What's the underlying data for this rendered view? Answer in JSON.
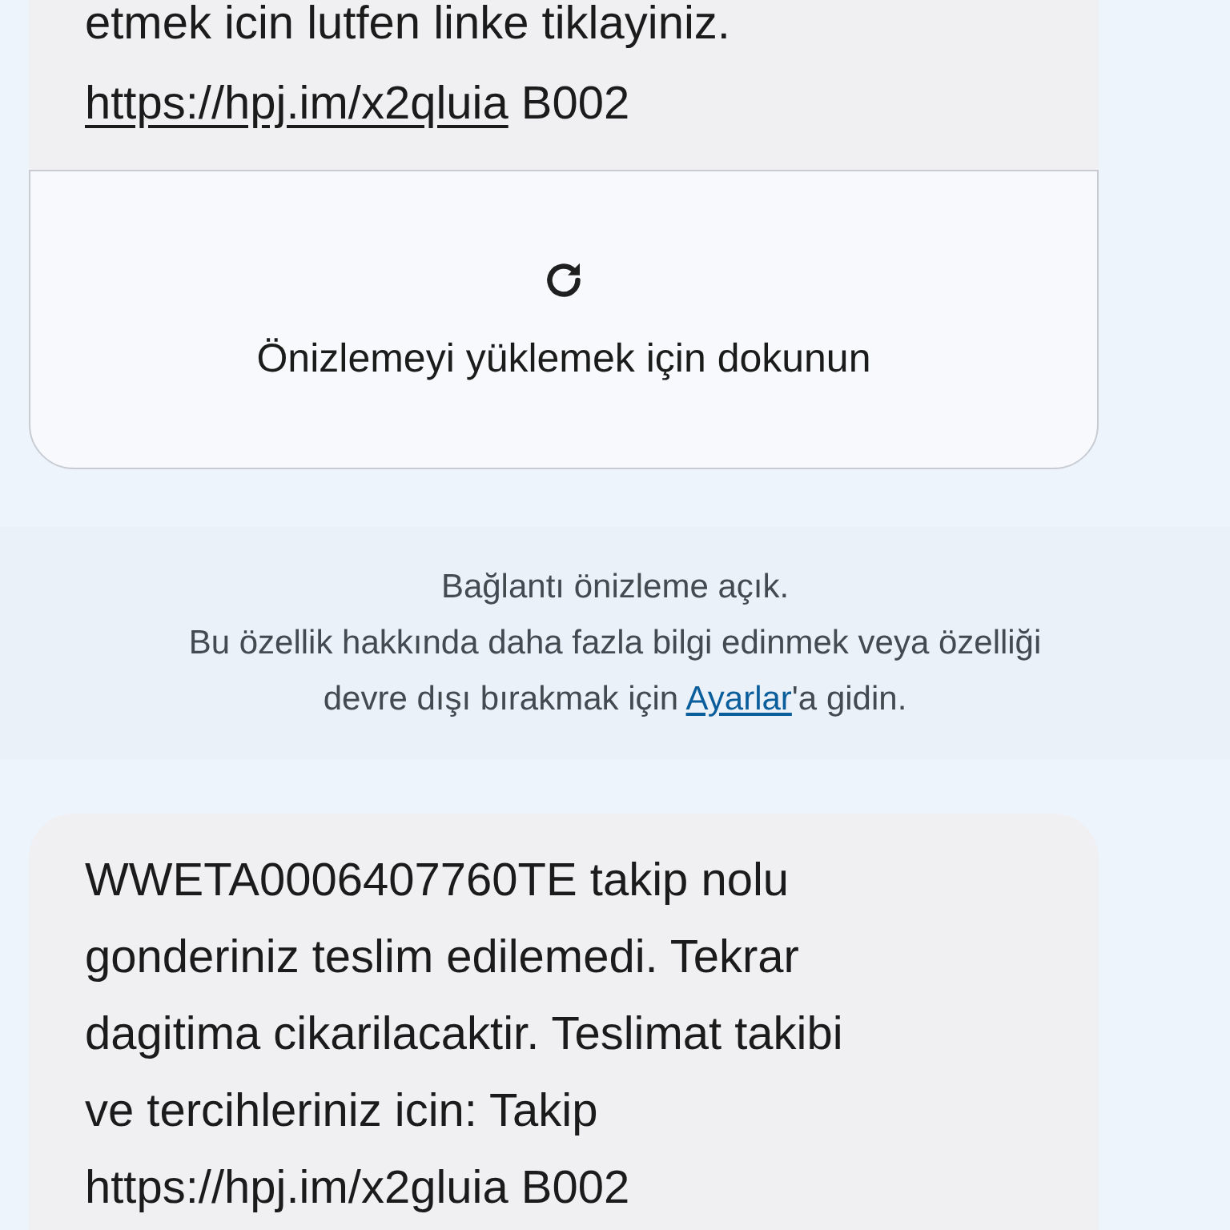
{
  "messages": [
    {
      "kind": "link_preview",
      "text_before": "etmek icin lutfen linke tiklayiniz.\n",
      "link": "https://hpj.im/x2qluia",
      "text_after": " B002",
      "preview": {
        "label": "Önizlemeyi yüklemek için dokunun"
      }
    },
    {
      "kind": "plain",
      "text": "WWETA0006407760TE takip nolu\ngonderiniz teslim edilemedi. Tekrar\ndagitima cikarilacaktir. Teslimat takibi\nve tercihleriniz icin: Takip\nhttps://hpj.im/x2gluia B002"
    }
  ],
  "notice": {
    "title": "Bağlantı önizleme açık.",
    "text_before": "Bu özellik hakkında daha fazla bilgi edinmek veya özelliği\ndevre dışı bırakmak için ",
    "link": "Ayarlar",
    "text_after": "'a gidin."
  }
}
